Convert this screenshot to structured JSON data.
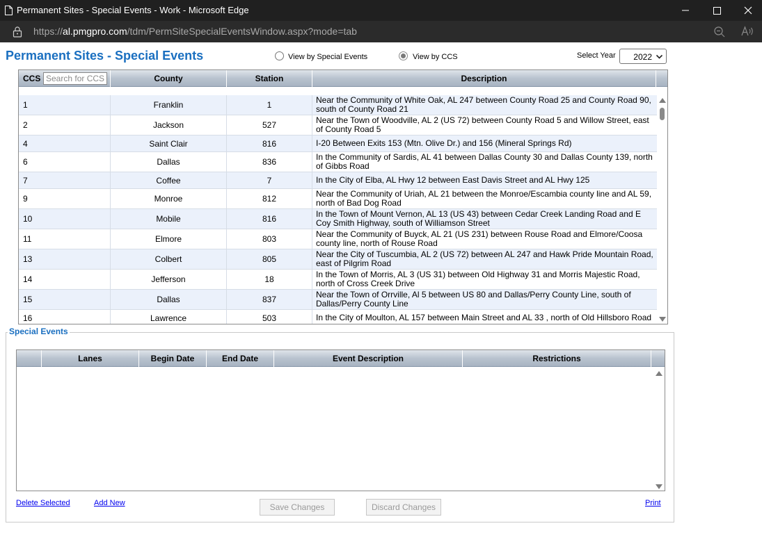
{
  "window": {
    "title": "Permanent Sites - Special Events - Work - Microsoft Edge",
    "url_prefix": "https://",
    "url_domain": "al.pmgpro.com",
    "url_path": "/tdm/PermSiteSpecialEventsWindow.aspx?mode=tab"
  },
  "page": {
    "title": "Permanent Sites - Special Events",
    "view_by_events_label": "View by Special Events",
    "view_by_ccs_label": "View by CCS",
    "selected_view": "View by CCS",
    "year_label": "Select Year",
    "year_value": "2022"
  },
  "grid": {
    "headers": {
      "ccs": "CCS",
      "search_placeholder": "Search for CCS",
      "county": "County",
      "station": "Station",
      "description": "Description"
    },
    "rows": [
      {
        "ccs": "1",
        "county": "Franklin",
        "station": "1",
        "description": "Near the Community of White Oak, AL 247 between County Road 25 and County Road 90, south of County Road 21"
      },
      {
        "ccs": "2",
        "county": "Jackson",
        "station": "527",
        "description": "Near the Town of Woodville, AL 2 (US 72) between County Road 5 and Willow Street, east of County Road 5"
      },
      {
        "ccs": "4",
        "county": "Saint Clair",
        "station": "816",
        "description": "I-20 Between Exits 153 (Mtn. Olive Dr.) and 156 (Mineral Springs Rd)"
      },
      {
        "ccs": "6",
        "county": "Dallas",
        "station": "836",
        "description": "In the Community of Sardis, AL 41 between Dallas County 30 and Dallas County 139, north of Gibbs Road"
      },
      {
        "ccs": "7",
        "county": "Coffee",
        "station": "7",
        "description": "In the City of Elba, AL Hwy 12 between East Davis Street and AL Hwy 125"
      },
      {
        "ccs": "9",
        "county": "Monroe",
        "station": "812",
        "description": "Near the Community of Uriah, AL 21 between the Monroe/Escambia county line and AL 59, north of Bad Dog Road"
      },
      {
        "ccs": "10",
        "county": "Mobile",
        "station": "816",
        "description": "In the Town of Mount Vernon, AL 13 (US 43) between Cedar Creek Landing Road and E Coy Smith Highway, south of Williamson Street"
      },
      {
        "ccs": "11",
        "county": "Elmore",
        "station": "803",
        "description": "Near the Community of Buyck, AL 21 (US 231) between Rouse Road and Elmore/Coosa county line, north of Rouse Road"
      },
      {
        "ccs": "13",
        "county": "Colbert",
        "station": "805",
        "description": "Near the City of Tuscumbia, AL 2 (US 72) between AL 247 and Hawk Pride Mountain Road, east of Pilgrim Road"
      },
      {
        "ccs": "14",
        "county": "Jefferson",
        "station": "18",
        "description": "In the Town of Morris, AL 3 (US 31) between Old Highway 31 and Morris Majestic Road, north of Cross Creek Drive"
      },
      {
        "ccs": "15",
        "county": "Dallas",
        "station": "837",
        "description": "Near the Town of Orrville, Al 5 between US 80 and Dallas/Perry County Line, south of Dallas/Perry County Line"
      },
      {
        "ccs": "16",
        "county": "Lawrence",
        "station": "503",
        "description": "In the City of Moulton, AL 157 between Main Street and AL 33 , north of Old Hillsboro Road"
      }
    ]
  },
  "special_events": {
    "legend": "Special Events",
    "headers": {
      "lanes": "Lanes",
      "begin_date": "Begin Date",
      "end_date": "End Date",
      "event_description": "Event Description",
      "restrictions": "Restrictions"
    },
    "delete_label": "Delete Selected",
    "add_label": "Add New",
    "save_label": "Save Changes",
    "discard_label": "Discard Changes",
    "print_label": "Print"
  }
}
